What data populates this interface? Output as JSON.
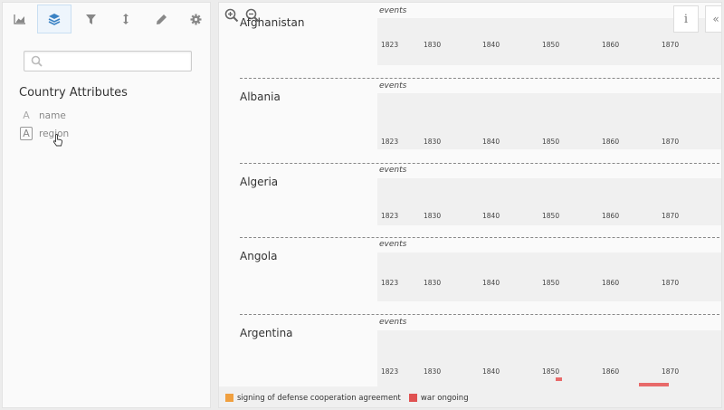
{
  "toolbar": {
    "tools": [
      {
        "name": "chart-icon",
        "color": "#888"
      },
      {
        "name": "layers-icon",
        "color": "#3a82c4"
      },
      {
        "name": "filter-icon",
        "color": "#888"
      },
      {
        "name": "sort-vertical-icon",
        "color": "#888"
      },
      {
        "name": "pencil-icon",
        "color": "#888"
      },
      {
        "name": "gear-icon",
        "color": "#888"
      }
    ],
    "active_tool": "layers-icon"
  },
  "search": {
    "placeholder": ""
  },
  "attributes": {
    "title": "Country Attributes",
    "items": [
      {
        "type_glyph": "A",
        "label": "name"
      },
      {
        "type_glyph": "A",
        "label": "region"
      }
    ]
  },
  "main": {
    "info_label": "i",
    "collapse_label": "«",
    "events_label": "events",
    "ticks": [
      "1823",
      "1830",
      "1840",
      "1850",
      "1860",
      "1870"
    ],
    "countries": [
      {
        "name": "Afghanistan"
      },
      {
        "name": "Albania"
      },
      {
        "name": "Algeria"
      },
      {
        "name": "Angola"
      },
      {
        "name": "Argentina"
      }
    ]
  },
  "legend": [
    {
      "label": "signing of defense cooperation agreement",
      "color": "#f0a040"
    },
    {
      "label": "war ongoing",
      "color": "#e05252"
    }
  ],
  "colors": {
    "accent": "#3a82c4",
    "war": "#e86a6a"
  }
}
